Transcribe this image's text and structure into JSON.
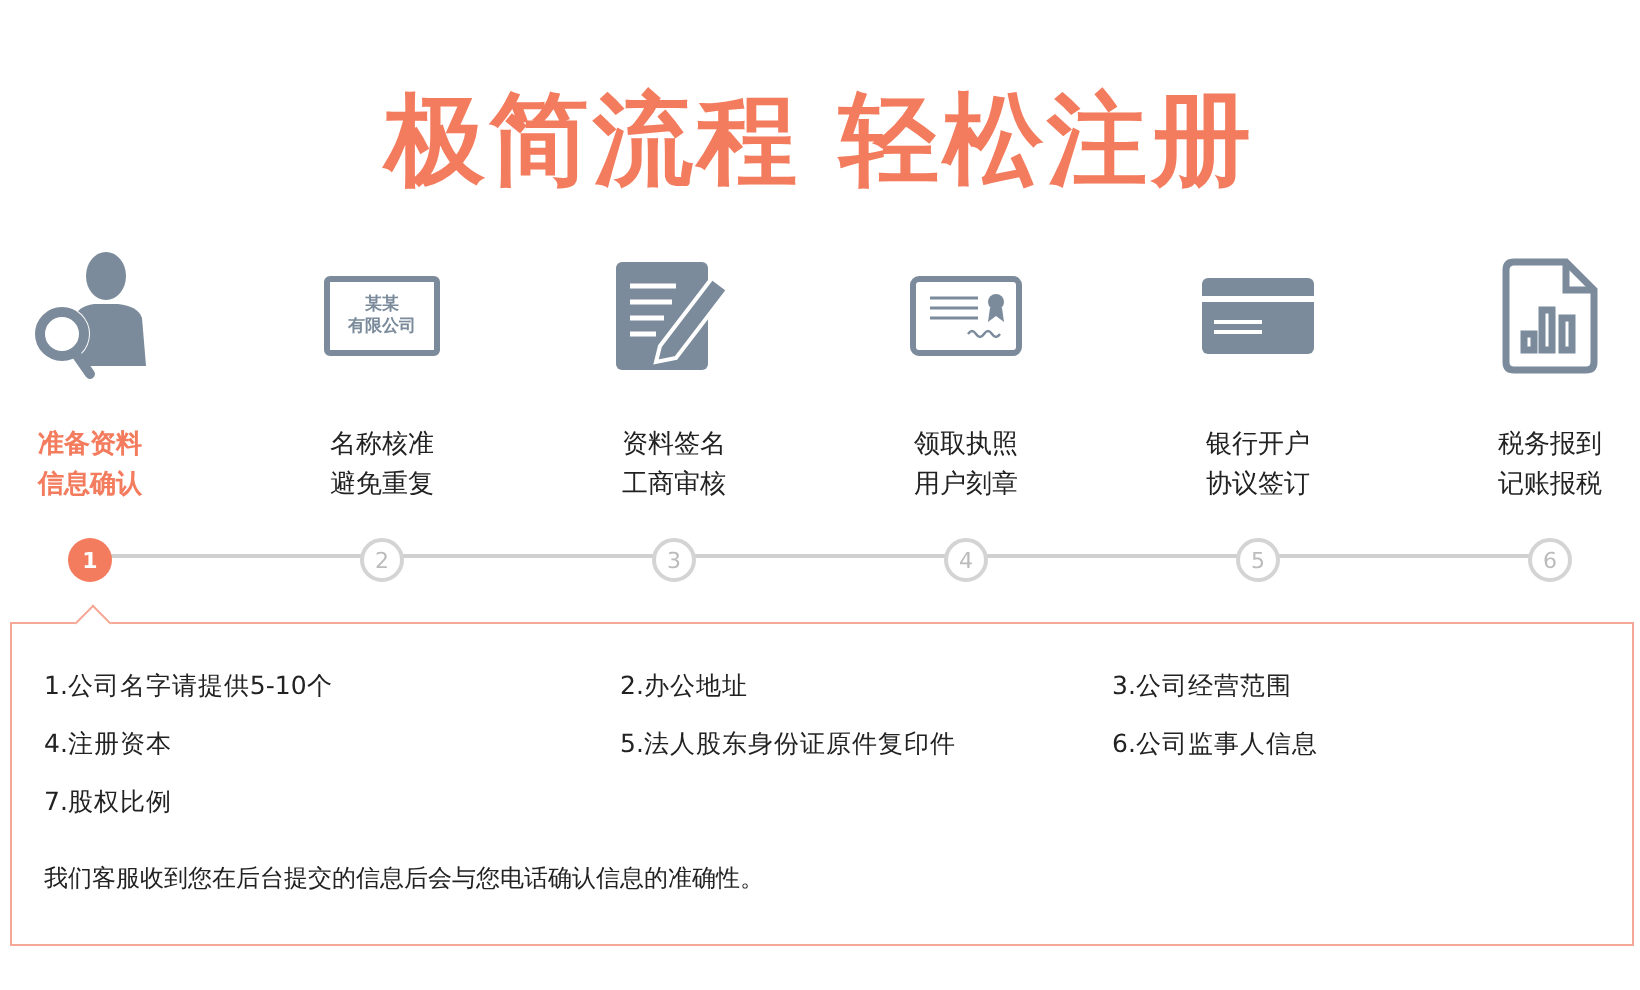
{
  "headline": "极简流程 轻松注册",
  "steps": [
    {
      "kind": "person-search",
      "label_lines": [
        "准备资料",
        "信息确认"
      ],
      "number": "1",
      "selected": true
    },
    {
      "kind": "nameplate",
      "badge_lines": [
        "某某",
        "有限公司"
      ],
      "label_lines": [
        "名称核准",
        "避免重复"
      ],
      "number": "2",
      "selected": false
    },
    {
      "kind": "document-pen",
      "label_lines": [
        "资料签名",
        "工商审核"
      ],
      "number": "3",
      "selected": false
    },
    {
      "kind": "certificate",
      "label_lines": [
        "领取执照",
        "用户刻章"
      ],
      "number": "4",
      "selected": false
    },
    {
      "kind": "card",
      "label_lines": [
        "银行开户",
        "协议签订"
      ],
      "number": "5",
      "selected": false
    },
    {
      "kind": "report",
      "label_lines": [
        "税务报到",
        "记账报税"
      ],
      "number": "6",
      "selected": false
    }
  ],
  "panel": {
    "items": [
      "1.公司名字请提供5-10个",
      "2.办公地址",
      "3.公司经营范围",
      "4.注册资本",
      "5.法人股东身份证原件复印件",
      "6.公司监事人信息",
      "7.股权比例"
    ],
    "note": "我们客服收到您在后台提交的信息后会与您电话确认信息的准确性。"
  }
}
